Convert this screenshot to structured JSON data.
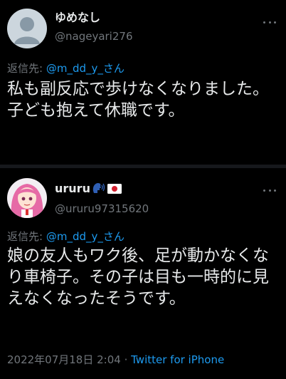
{
  "tweets": [
    {
      "name": "ゆめなし",
      "handle": "@nageyari276",
      "reply_prefix": "返信先: ",
      "reply_to": "@m_dd_y_さん",
      "text": "私も副反応で歩けなくなりました。子ども抱えて休職です。"
    },
    {
      "name": "ururu",
      "name_icons": [
        "speaking-head-icon",
        "japan-flag-icon"
      ],
      "handle": "@ururu97315620",
      "reply_prefix": "返信先: ",
      "reply_to": "@m_dd_y_さん",
      "text": "娘の友人もワク後、足が動かなくなり車椅子。その子は目も一時的に見えなくなったそうです。",
      "timestamp": "2022年07月18日 2:04",
      "separator": " · ",
      "source": "Twitter for iPhone"
    }
  ],
  "colors": {
    "background": "#000000",
    "text": "#e7e9ea",
    "secondary": "#71767b",
    "link": "#1d9bf0"
  }
}
